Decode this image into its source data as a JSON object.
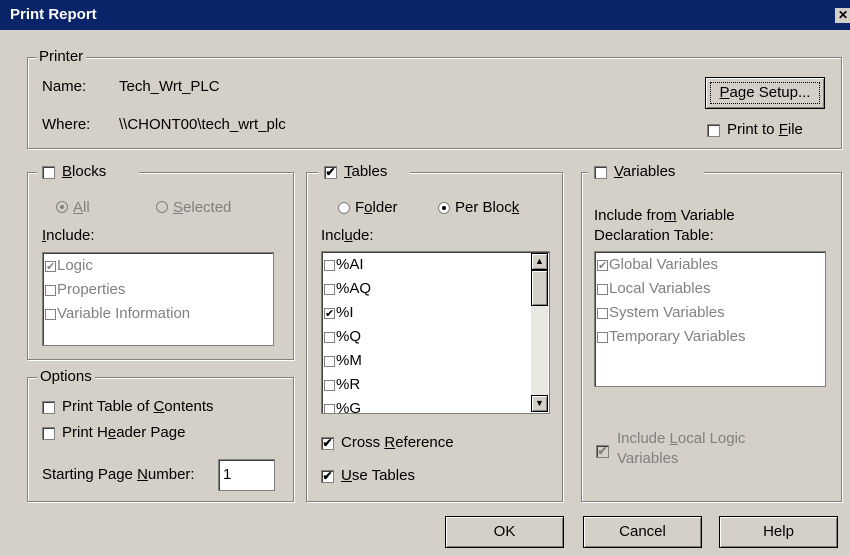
{
  "window": {
    "title": "Print Report",
    "close_glyph": "✕"
  },
  "printer": {
    "legend": "Printer",
    "name_label": "Name:",
    "name_value": "Tech_Wrt_PLC",
    "where_label": "Where:",
    "where_value": "\\\\CHONT00\\tech_wrt_plc",
    "page_setup_label": "Page Setup...",
    "print_to_file_label": "Print to File",
    "print_to_file_checked": false
  },
  "blocks": {
    "legend": "Blocks",
    "checked": false,
    "radio_all": "All",
    "radio_selected": "Selected",
    "include_label": "Include:",
    "items": [
      {
        "label": "Logic",
        "checked": true
      },
      {
        "label": "Properties",
        "checked": false
      },
      {
        "label": "Variable Information",
        "checked": false
      }
    ]
  },
  "options": {
    "legend": "Options",
    "toc_label": "Print Table of Contents",
    "header_label": "Print Header Page",
    "start_page_label": "Starting Page Number:",
    "start_page_value": "1"
  },
  "tables": {
    "legend": "Tables",
    "checked": true,
    "radio_folder": "Folder",
    "radio_per_block": "Per Block",
    "include_label": "Include:",
    "items": [
      {
        "label": "%AI",
        "checked": false
      },
      {
        "label": "%AQ",
        "checked": false
      },
      {
        "label": "%I",
        "checked": true
      },
      {
        "label": "%Q",
        "checked": false
      },
      {
        "label": "%M",
        "checked": false
      },
      {
        "label": "%R",
        "checked": false
      },
      {
        "label": "%G",
        "checked": false
      }
    ],
    "cross_ref_label": "Cross Reference",
    "cross_ref_checked": true,
    "use_tables_label": "Use Tables",
    "use_tables_checked": true
  },
  "variables": {
    "legend": "Variables",
    "checked": false,
    "include_line1": "Include from Variable",
    "include_line2": "Declaration Table:",
    "items": [
      {
        "label": "Global Variables",
        "checked": true
      },
      {
        "label": "Local Variables",
        "checked": false
      },
      {
        "label": "System Variables",
        "checked": false
      },
      {
        "label": "Temporary Variables",
        "checked": false
      }
    ],
    "local_logic_line1": "Include Local Logic",
    "local_logic_line2": "Variables"
  },
  "buttons": {
    "ok": "OK",
    "cancel": "Cancel",
    "help": "Help"
  },
  "colors": {
    "face": "#d4d0c8",
    "title_bar": "#0a246a",
    "disabled_text": "#808080"
  }
}
